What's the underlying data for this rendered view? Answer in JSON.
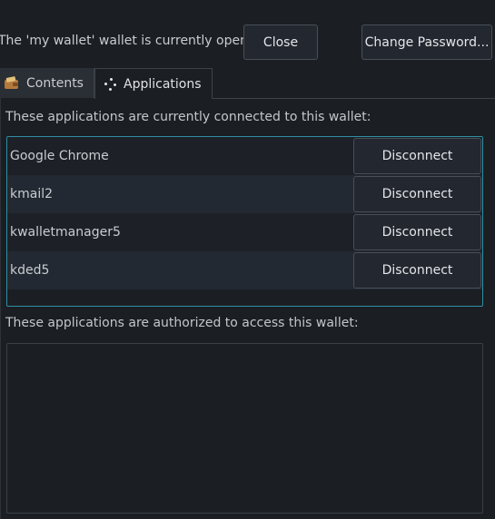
{
  "status_text": "The 'my wallet' wallet is currently open",
  "toolbar": {
    "close_label": "Close",
    "change_password_label": "Change Password..."
  },
  "tabs": [
    {
      "label": "Contents",
      "icon": "wallet-icon",
      "active": false
    },
    {
      "label": "Applications",
      "icon": "applications-icon",
      "active": true
    }
  ],
  "connected": {
    "label": "These applications are currently connected to this wallet:",
    "rows": [
      {
        "name": "Google Chrome",
        "action": "Disconnect"
      },
      {
        "name": "kmail2",
        "action": "Disconnect"
      },
      {
        "name": "kwalletmanager5",
        "action": "Disconnect"
      },
      {
        "name": "kded5",
        "action": "Disconnect"
      }
    ]
  },
  "authorized": {
    "label": "These applications are authorized to access this wallet:",
    "rows": []
  },
  "colors": {
    "background": "#1b1e23",
    "row_alternate": "#232932",
    "row_plain": "#1d2127",
    "focus_border": "#2f8fa3"
  }
}
